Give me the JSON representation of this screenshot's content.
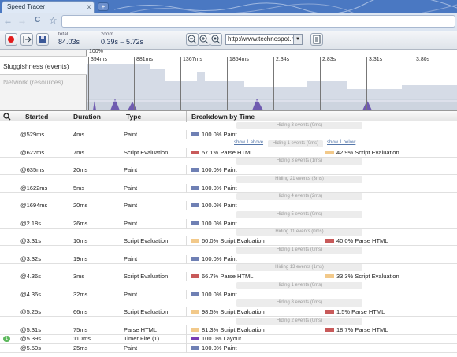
{
  "browser": {
    "tab_title": "Speed Tracer",
    "tab_close": "x",
    "newtab": "+",
    "back": "←",
    "forward": "→",
    "reload": "C",
    "star": "☆"
  },
  "toolbar": {
    "total_label": "total",
    "total_value": "84.03s",
    "zoom_label": "zoom",
    "zoom_value": "0.39s – 5.72s",
    "url": "http://www.technospot.ne",
    "icons": [
      "record-icon",
      "clear-icon",
      "save-icon",
      "zoom-out-icon",
      "zoom-in-icon",
      "zoom-fit-icon",
      "notes-icon"
    ]
  },
  "overview": {
    "percent_label": "100%",
    "lane_sluggishness": "Sluggishness (events)",
    "lane_network": "Network (resources)",
    "ticks": [
      "394ms",
      "881ms",
      "1367ms",
      "1854ms",
      "2.34s",
      "2.83s",
      "3.31s",
      "3.80s"
    ]
  },
  "table": {
    "headers": {
      "started": "Started",
      "duration": "Duration",
      "type": "Type",
      "breakdown": "Breakdown by Time"
    },
    "show_above": "show 1 above",
    "show_below": "show 1 below",
    "rows": [
      {
        "hide": "Hiding 3 events (0ms)"
      },
      {
        "started": "@529ms",
        "duration": "4ms",
        "type": "Paint",
        "b1": "100.0% Paint",
        "c1": "#6f80b4"
      },
      {
        "hide": "Hiding 1 events (0ms)",
        "links": true
      },
      {
        "started": "@622ms",
        "duration": "7ms",
        "type": "Script Evaluation",
        "b1": "57.1% Parse HTML",
        "c1": "#c85a5a",
        "b2": "42.9% Script Evaluation",
        "c2": "#f2c98a"
      },
      {
        "hide": "Hiding 3 events (1ms)"
      },
      {
        "started": "@635ms",
        "duration": "20ms",
        "type": "Paint",
        "b1": "100.0% Paint",
        "c1": "#6f80b4"
      },
      {
        "hide": "Hiding 21 events (3ms)"
      },
      {
        "started": "@1622ms",
        "duration": "5ms",
        "type": "Paint",
        "b1": "100.0% Paint",
        "c1": "#6f80b4"
      },
      {
        "hide": "Hiding 4 events (2ms)"
      },
      {
        "started": "@1694ms",
        "duration": "20ms",
        "type": "Paint",
        "b1": "100.0% Paint",
        "c1": "#6f80b4"
      },
      {
        "hide": "Hiding 5 events (0ms)"
      },
      {
        "started": "@2.18s",
        "duration": "26ms",
        "type": "Paint",
        "b1": "100.0% Paint",
        "c1": "#6f80b4"
      },
      {
        "hide": "Hiding 11 events (0ms)"
      },
      {
        "started": "@3.31s",
        "duration": "10ms",
        "type": "Script Evaluation",
        "b1": "60.0% Script Evaluation",
        "c1": "#f2c98a",
        "b2": "40.0% Parse HTML",
        "c2": "#c85a5a"
      },
      {
        "hide": "Hiding 1 events (0ms)"
      },
      {
        "started": "@3.32s",
        "duration": "19ms",
        "type": "Paint",
        "b1": "100.0% Paint",
        "c1": "#6f80b4"
      },
      {
        "hide": "Hiding 13 events (1ms)"
      },
      {
        "started": "@4.36s",
        "duration": "3ms",
        "type": "Script Evaluation",
        "b1": "66.7% Parse HTML",
        "c1": "#c85a5a",
        "b2": "33.3% Script Evaluation",
        "c2": "#f2c98a"
      },
      {
        "hide": "Hiding 1 events (0ms)"
      },
      {
        "started": "@4.36s",
        "duration": "32ms",
        "type": "Paint",
        "b1": "100.0% Paint",
        "c1": "#6f80b4"
      },
      {
        "hide": "Hiding 8 events (0ms)"
      },
      {
        "started": "@5.25s",
        "duration": "66ms",
        "type": "Script Evaluation",
        "b1": "98.5% Script Evaluation",
        "c1": "#f2c98a",
        "b2": "1.5% Parse HTML",
        "c2": "#c85a5a"
      },
      {
        "hide": "Hiding 2 events (0ms)"
      },
      {
        "started": "@5.31s",
        "duration": "75ms",
        "type": "Parse HTML",
        "b1": "81.3% Script Evaluation",
        "c1": "#f2c98a",
        "b2": "18.7% Parse HTML",
        "c2": "#c85a5a"
      },
      {
        "started": "@5.39s",
        "duration": "110ms",
        "type": "Timer Fire (1)",
        "b1": "100.0% Layout",
        "c1": "#7a3fb5",
        "badge": "1"
      },
      {
        "started": "@5.50s",
        "duration": "25ms",
        "type": "Paint",
        "b1": "100.0% Paint",
        "c1": "#6f80b4"
      }
    ]
  }
}
